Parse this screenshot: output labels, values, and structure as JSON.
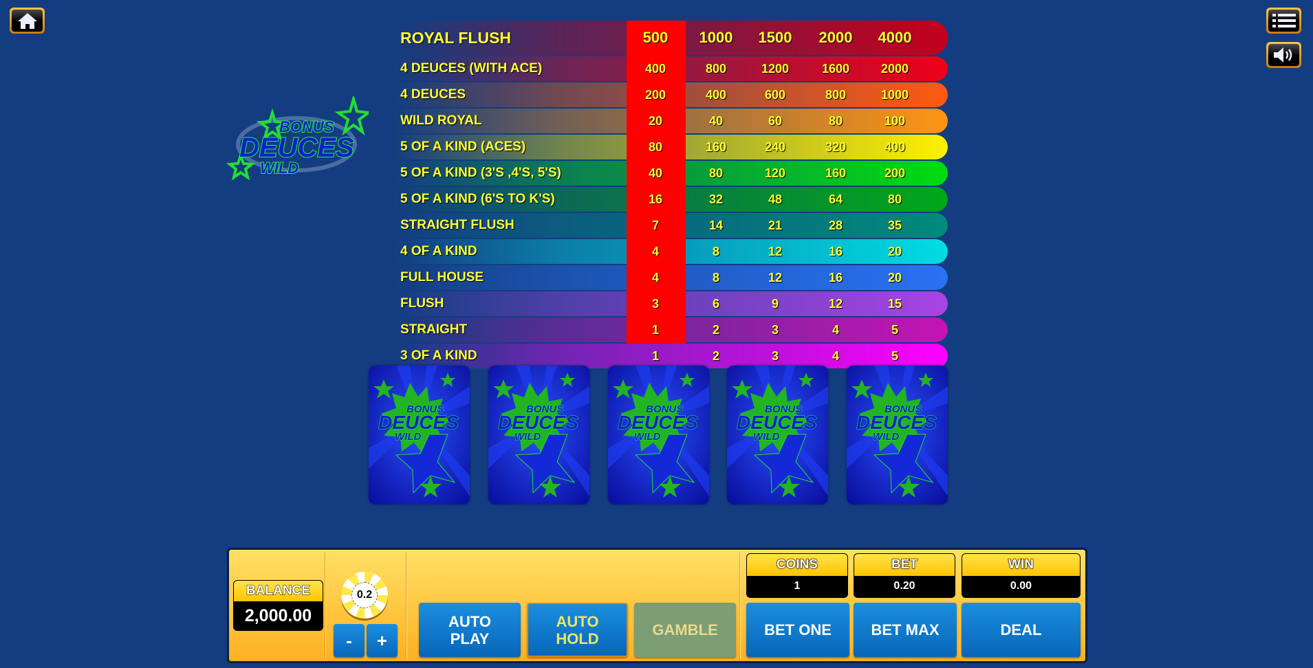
{
  "top": {
    "home_icon": "home-icon",
    "menu_icon": "menu-list-icon",
    "sound_icon": "speaker-icon"
  },
  "logo": {
    "line1": "BONUS",
    "line2": "DEUCES",
    "line3": "WILD"
  },
  "paytable": {
    "header": {
      "hand": "ROYAL FLUSH",
      "values": [
        "500",
        "1000",
        "1500",
        "2000",
        "4000"
      ],
      "color": "#c4001c"
    },
    "highlight_column": 1,
    "highlight_color": "#ff0000",
    "rows": [
      {
        "hand": "4 DEUCES (WITH ACE)",
        "values": [
          "400",
          "800",
          "1200",
          "1600",
          "2000"
        ],
        "color": "#ee0018"
      },
      {
        "hand": "4 DEUCES",
        "values": [
          "200",
          "400",
          "600",
          "800",
          "1000"
        ],
        "color": "#ff5a10"
      },
      {
        "hand": "WILD ROYAL",
        "values": [
          "20",
          "40",
          "60",
          "80",
          "100"
        ],
        "color": "#ff9414"
      },
      {
        "hand": "5 OF A KIND (ACES)",
        "values": [
          "80",
          "160",
          "240",
          "320",
          "400"
        ],
        "color": "#fff000"
      },
      {
        "hand": "5 OF A KIND (3'S ,4'S, 5'S)",
        "values": [
          "40",
          "80",
          "120",
          "160",
          "200"
        ],
        "color": "#00dc10"
      },
      {
        "hand": "5 OF A KIND (6'S TO K'S)",
        "values": [
          "16",
          "32",
          "48",
          "64",
          "80"
        ],
        "color": "#00a818"
      },
      {
        "hand": "STRAIGHT FLUSH",
        "values": [
          "7",
          "14",
          "21",
          "28",
          "35"
        ],
        "color": "#008a7c"
      },
      {
        "hand": "4 OF A KIND",
        "values": [
          "4",
          "8",
          "12",
          "16",
          "20"
        ],
        "color": "#00dce4"
      },
      {
        "hand": "FULL HOUSE",
        "values": [
          "4",
          "8",
          "12",
          "16",
          "20"
        ],
        "color": "#2a72f4"
      },
      {
        "hand": "FLUSH",
        "values": [
          "3",
          "6",
          "9",
          "12",
          "15"
        ],
        "color": "#a844e4"
      },
      {
        "hand": "STRAIGHT",
        "values": [
          "1",
          "2",
          "3",
          "4",
          "5"
        ],
        "color": "#c414b4"
      },
      {
        "hand": "3 OF A KIND",
        "values": [
          "1",
          "2",
          "3",
          "4",
          "5"
        ],
        "color": "#ff00ff"
      }
    ]
  },
  "cards": [
    {
      "state": "face-down"
    },
    {
      "state": "face-down"
    },
    {
      "state": "face-down"
    },
    {
      "state": "face-down"
    },
    {
      "state": "face-down"
    }
  ],
  "panel": {
    "balance_label": "BALANCE",
    "balance_value": "2,000.00",
    "chip_value": "0.2",
    "minus": "-",
    "plus": "+",
    "auto_play": [
      "AUTO",
      "PLAY"
    ],
    "auto_hold": [
      "AUTO",
      "HOLD"
    ],
    "gamble": "GAMBLE",
    "coins_label": "COINS",
    "coins_value": "1",
    "bet_label": "BET",
    "bet_value": "0.20",
    "win_label": "WIN",
    "win_value": "0.00",
    "bet_one": "BET ONE",
    "bet_max": "BET MAX",
    "deal": "DEAL"
  }
}
